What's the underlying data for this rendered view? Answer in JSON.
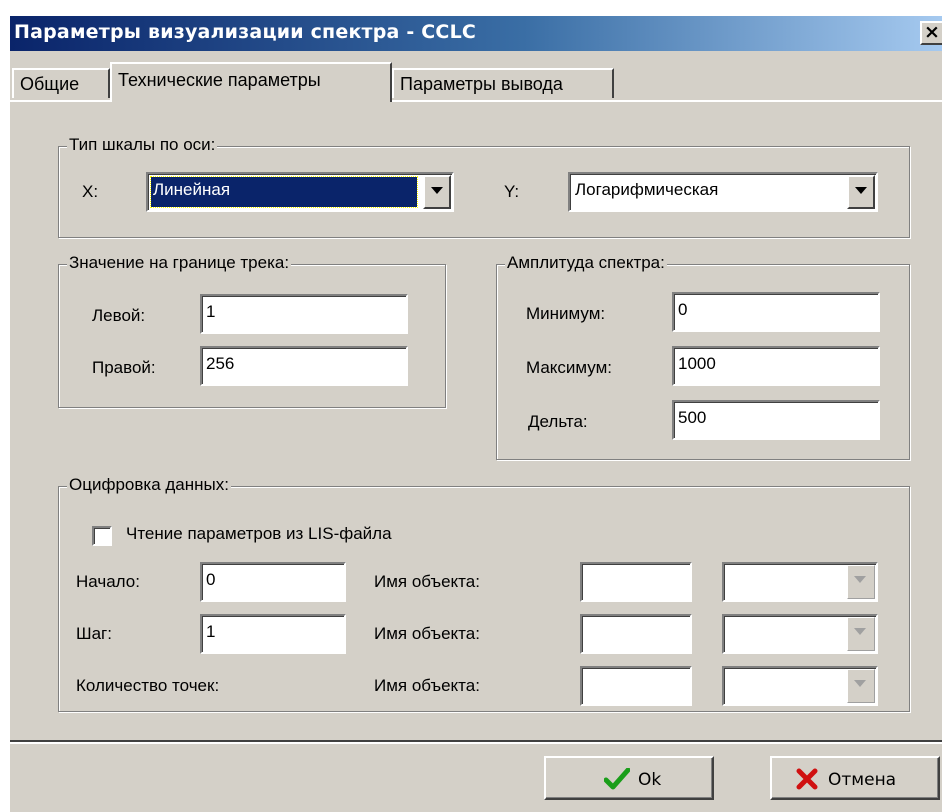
{
  "window": {
    "title": "Параметры визуализации спектра - CCLC",
    "close_glyph": "×"
  },
  "tabs": [
    {
      "label": "Общие",
      "active": false
    },
    {
      "label": "Технические параметры",
      "active": true
    },
    {
      "label": "Параметры вывода",
      "active": false
    }
  ],
  "scale_group": {
    "legend": "Тип шкалы по оси:",
    "x_label": "X:",
    "x_value": "Линейная",
    "y_label": "Y:",
    "y_value": "Логарифмическая"
  },
  "track_group": {
    "legend": "Значение на границе трека:",
    "left_label": "Левой:",
    "left_value": "1",
    "right_label": "Правой:",
    "right_value": "256"
  },
  "amplitude_group": {
    "legend": "Амплитуда спектра:",
    "min_label": "Минимум:",
    "min_value": "0",
    "max_label": "Максимум:",
    "max_value": "1000",
    "delta_label": "Дельта:",
    "delta_value": "500"
  },
  "digitize_group": {
    "legend": "Оцифровка данных:",
    "checkbox_label": "Чтение параметров из LIS-файла",
    "checkbox_checked": false,
    "start_label": "Начало:",
    "start_value": "0",
    "step_label": "Шаг:",
    "step_value": "1",
    "count_label": "Количество точек:",
    "object_label_1": "Имя объекта:",
    "object_label_2": "Имя объекта:",
    "object_label_3": "Имя объекта:"
  },
  "buttons": {
    "ok": "Ok",
    "cancel": "Отмена"
  },
  "colors": {
    "title_start": "#0a246a",
    "title_end": "#a6caf0",
    "face": "#d4d0c8",
    "ok_icon": "#1a9e1a",
    "cancel_icon": "#d01010"
  }
}
